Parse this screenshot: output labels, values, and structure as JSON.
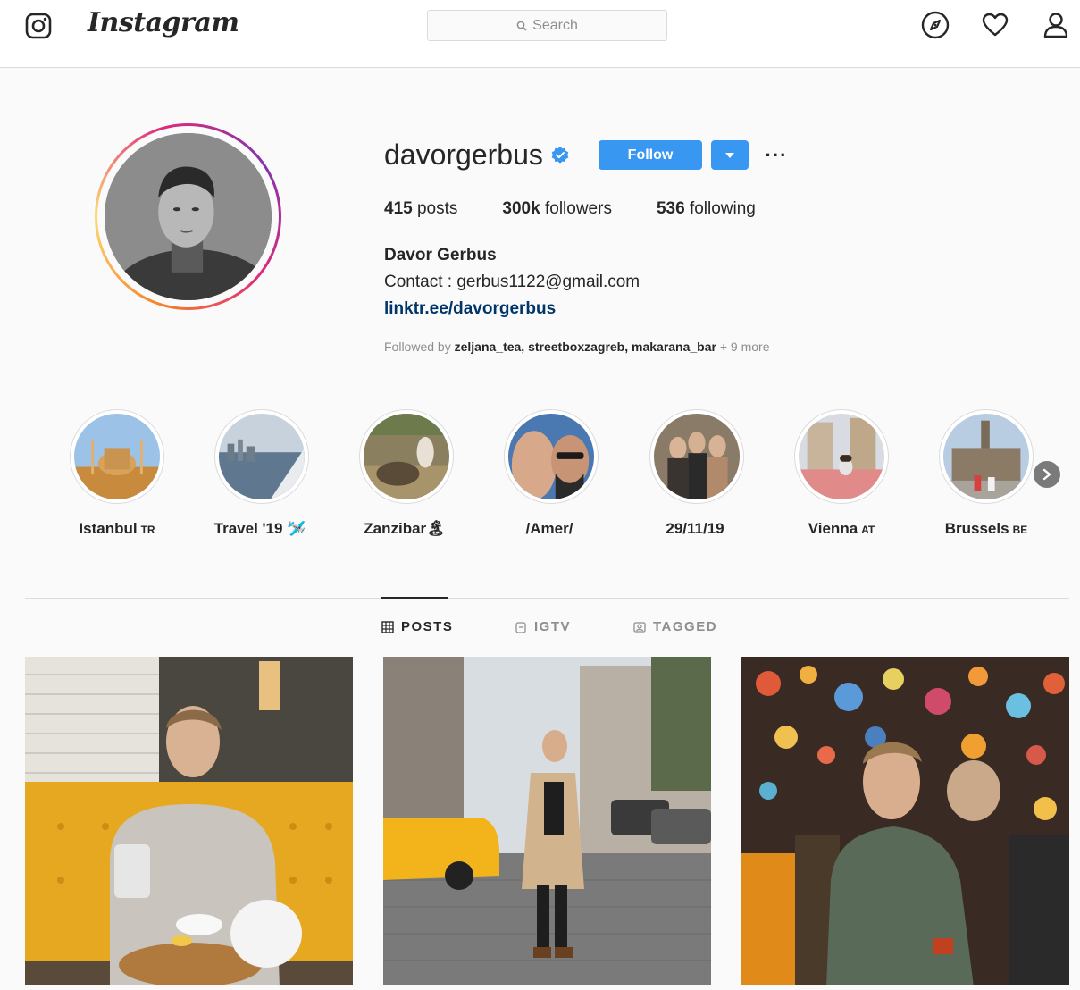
{
  "nav": {
    "search_placeholder": "Search"
  },
  "profile": {
    "username": "davorgerbus",
    "verified": true,
    "follow_label": "Follow",
    "more_label": "···",
    "stats": [
      {
        "value": "415",
        "label": "posts"
      },
      {
        "value": "300k",
        "label": "followers"
      },
      {
        "value": "536",
        "label": "following"
      }
    ],
    "full_name": "Davor Gerbus",
    "bio": "Contact : gerbus1122@gmail.com",
    "link": "linktr.ee/davorgerbus",
    "followed_by_prefix": "Followed by ",
    "followed_by_names": "zeljana_tea, streetboxzagreb, makarana_bar",
    "followed_by_suffix": " + 9 more"
  },
  "highlights": [
    {
      "label": "Istanbul",
      "code": "TR"
    },
    {
      "label": "Travel '19 🛩️",
      "code": ""
    },
    {
      "label": "Zanzibar🏝",
      "code": ""
    },
    {
      "label": "/Amer/",
      "code": ""
    },
    {
      "label": "29/11/19",
      "code": ""
    },
    {
      "label": "Vienna",
      "code": "AT"
    },
    {
      "label": "Brussels",
      "code": "BE"
    }
  ],
  "tabs": [
    {
      "label": "POSTS",
      "icon": "grid-icon",
      "active": true
    },
    {
      "label": "IGTV",
      "icon": "igtv-icon",
      "active": false
    },
    {
      "label": "TAGGED",
      "icon": "tagged-icon",
      "active": false
    }
  ],
  "colors": {
    "accent": "#3897f0",
    "link": "#003569",
    "muted": "#8e8e8e",
    "border": "#dbdbdb"
  }
}
